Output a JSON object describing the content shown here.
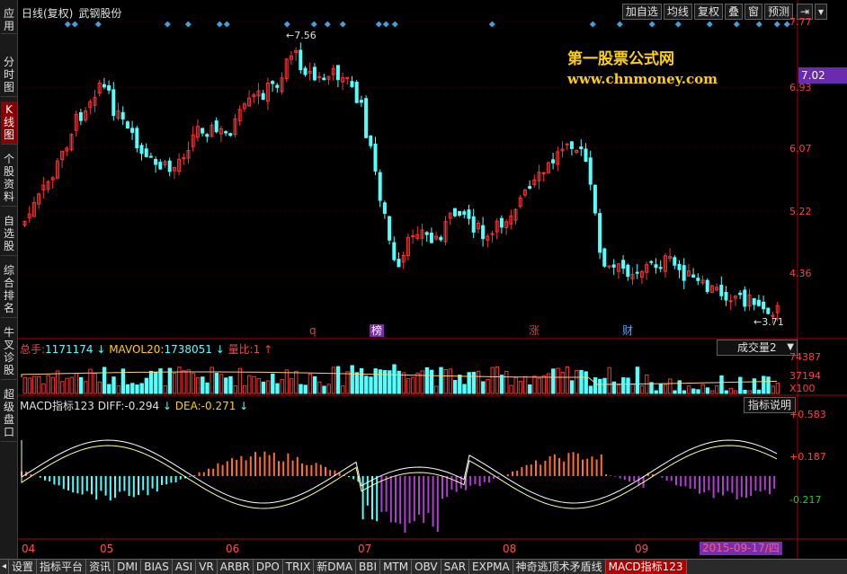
{
  "sidebar": {
    "items": [
      {
        "label": "应用"
      },
      {
        "label": "分时图"
      },
      {
        "label": "K线图"
      },
      {
        "label": "个股资料"
      },
      {
        "label": "自选股"
      },
      {
        "label": "综合排名"
      },
      {
        "label": "牛叉诊股"
      },
      {
        "label": "超级盘口"
      }
    ]
  },
  "header": {
    "period": "日线(复权)",
    "stock": "武钢股份",
    "buttons": [
      "加自选",
      "均线",
      "复权",
      "叠",
      "窗",
      "预测"
    ]
  },
  "watermark": {
    "line1": "第一股票公式网",
    "line2": "www.chnmoney.com"
  },
  "price_axis": {
    "labels": [
      "7.77",
      "6.93",
      "6.07",
      "5.22",
      "4.36"
    ],
    "current": "7.02",
    "high_annotation": "7.56",
    "low_annotation": "3.71"
  },
  "events": [
    "q",
    "榜",
    "涨",
    "财"
  ],
  "volume": {
    "title_total_label": "总手:",
    "title_total_value": "1171174",
    "mavol_label": "MAVOL20:",
    "mavol_value": "1738051",
    "ratio_label": "量比:",
    "ratio_value": "1",
    "select_value": "成交量2",
    "axis": [
      "74387",
      "37194",
      "X100"
    ]
  },
  "macd": {
    "name": "MACD指标123",
    "diff_label": "DIFF:",
    "diff_value": "-0.294",
    "dea_label": "DEA:",
    "dea_value": "-0.271",
    "desc_button": "指标说明",
    "axis": [
      "+0.583",
      "+0.187",
      "-0.217"
    ]
  },
  "x_axis": {
    "months": [
      "04",
      "05",
      "06",
      "07",
      "08",
      "09"
    ],
    "current_date": "2015-09-17/四"
  },
  "tabs": [
    "设置",
    "指标平台",
    "资讯",
    "DMI",
    "BIAS",
    "ASI",
    "VR",
    "ARBR",
    "DPO",
    "TRIX",
    "新DMA",
    "BBI",
    "MTM",
    "OBV",
    "SAR",
    "EXPMA",
    "神奇逃顶术矛盾线",
    "MACD指标123"
  ],
  "colors": {
    "up": "#ff3030",
    "down": "#54ffff",
    "axis": "#b00000",
    "accent": "#ffd000"
  },
  "chart_data": {
    "type": "candlestick",
    "x": [
      "04",
      "05",
      "06",
      "07",
      "08",
      "09"
    ],
    "price_range": [
      3.71,
      7.77
    ],
    "high": 7.56,
    "low": 3.71,
    "volume_range": [
      0,
      74387
    ],
    "macd_range": [
      -0.217,
      0.583
    ]
  }
}
